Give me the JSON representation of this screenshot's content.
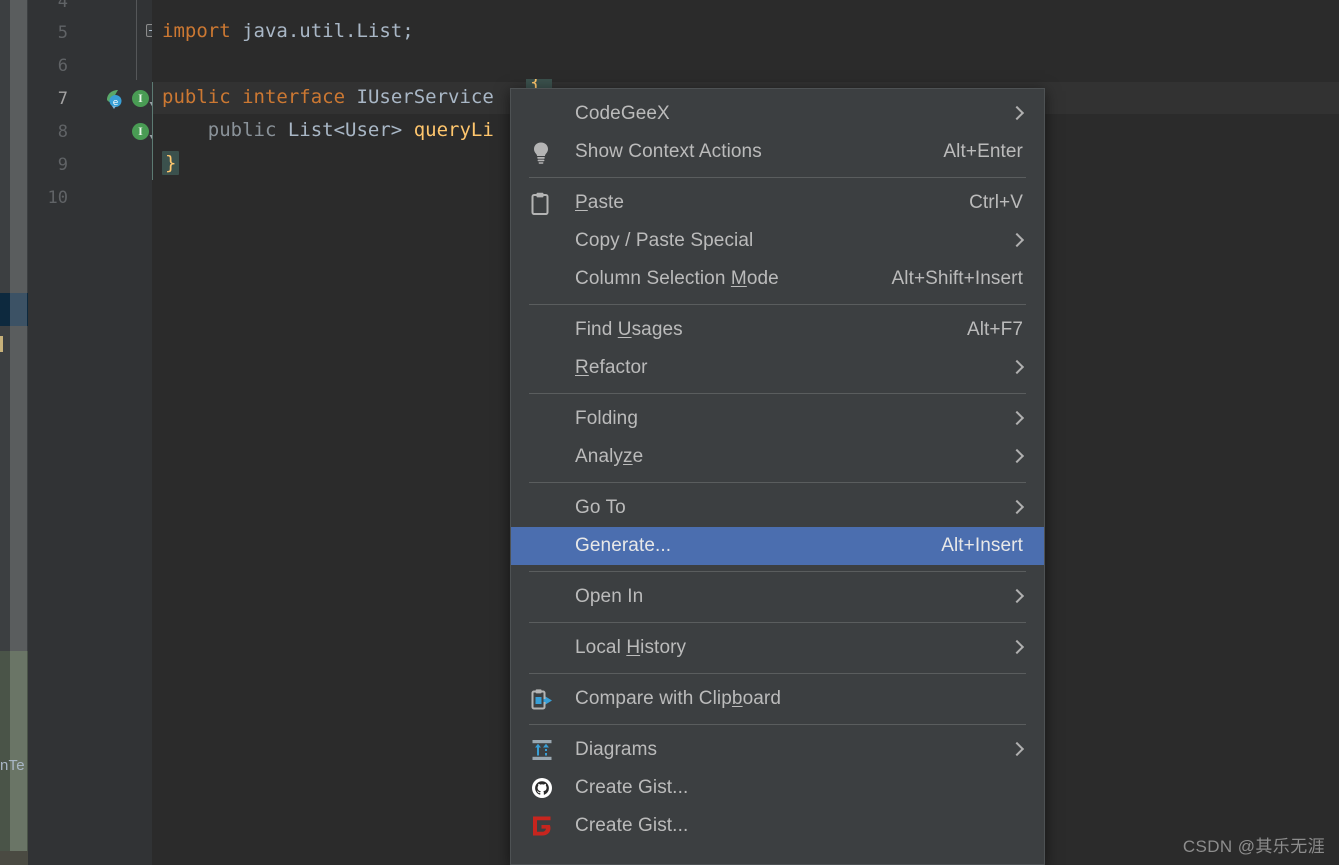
{
  "editor": {
    "gutter": {
      "line_numbers": [
        "4",
        "5",
        "6",
        "7",
        "8",
        "9",
        "10"
      ],
      "current_line": "7",
      "icons": [
        {
          "name": "mybatis-mapper-icon",
          "line": "7"
        },
        {
          "name": "implementation-badge-icon",
          "line": "7",
          "glyph": "I"
        },
        {
          "name": "implementation-badge-icon",
          "line": "8",
          "glyph": "I"
        }
      ]
    },
    "code_lines": [
      {
        "num": "5",
        "segments": [
          {
            "t": "import",
            "c": "kw"
          },
          {
            "t": " java",
            "c": "plain"
          },
          {
            "t": ".util.",
            "c": "plain"
          },
          {
            "t": "List",
            "c": "plain"
          },
          {
            "t": ";",
            "c": "plain"
          }
        ]
      },
      {
        "num": "6",
        "segments": []
      },
      {
        "num": "7",
        "segments": [
          {
            "t": "public",
            "c": "kw"
          },
          {
            "t": " ",
            "c": "plain"
          },
          {
            "t": "interface",
            "c": "kw"
          },
          {
            "t": " ",
            "c": "plain"
          },
          {
            "t": "IUserService",
            "c": "cls"
          }
        ]
      },
      {
        "num": "8",
        "segments": [
          {
            "t": "    ",
            "c": "plain"
          },
          {
            "t": "public",
            "c": "dim"
          },
          {
            "t": " ",
            "c": "plain"
          },
          {
            "t": "List<User>",
            "c": "plain"
          },
          {
            "t": " ",
            "c": "plain"
          },
          {
            "t": "queryLi",
            "c": "mtd"
          }
        ]
      },
      {
        "num": "9",
        "segments": [
          {
            "t": "}",
            "c": "brace-hl"
          }
        ]
      }
    ],
    "line5_text": "import java.util.List;",
    "line7_text": "public interface IUserService",
    "line8_text": "public List<User> queryLi",
    "line9_text": "}",
    "project_tree_label": "nTe"
  },
  "context_menu": {
    "groups": [
      {
        "items": [
          {
            "label": "CodeGeeX",
            "icon": "none",
            "shortcut": "",
            "submenu": true,
            "selected": false,
            "mnemonic": ""
          },
          {
            "label": "Show Context Actions",
            "icon": "lightbulb-icon",
            "shortcut": "Alt+Enter",
            "submenu": false,
            "selected": false,
            "mnemonic": ""
          }
        ]
      },
      {
        "items": [
          {
            "label": "Paste",
            "icon": "clipboard-icon",
            "shortcut": "Ctrl+V",
            "submenu": false,
            "selected": false,
            "mnemonic": "P"
          },
          {
            "label": "Copy / Paste Special",
            "icon": "none",
            "shortcut": "",
            "submenu": true,
            "selected": false,
            "mnemonic": ""
          },
          {
            "label": "Column Selection Mode",
            "icon": "none",
            "shortcut": "Alt+Shift+Insert",
            "submenu": false,
            "selected": false,
            "mnemonic": "M"
          }
        ]
      },
      {
        "items": [
          {
            "label": "Find Usages",
            "icon": "none",
            "shortcut": "Alt+F7",
            "submenu": false,
            "selected": false,
            "mnemonic": "U"
          },
          {
            "label": "Refactor",
            "icon": "none",
            "shortcut": "",
            "submenu": true,
            "selected": false,
            "mnemonic": "R"
          }
        ]
      },
      {
        "items": [
          {
            "label": "Folding",
            "icon": "none",
            "shortcut": "",
            "submenu": true,
            "selected": false,
            "mnemonic": ""
          },
          {
            "label": "Analyze",
            "icon": "none",
            "shortcut": "",
            "submenu": true,
            "selected": false,
            "mnemonic": "z"
          }
        ]
      },
      {
        "items": [
          {
            "label": "Go To",
            "icon": "none",
            "shortcut": "",
            "submenu": true,
            "selected": false,
            "mnemonic": ""
          },
          {
            "label": "Generate...",
            "icon": "none",
            "shortcut": "Alt+Insert",
            "submenu": false,
            "selected": true,
            "mnemonic": ""
          }
        ]
      },
      {
        "items": [
          {
            "label": "Open In",
            "icon": "none",
            "shortcut": "",
            "submenu": true,
            "selected": false,
            "mnemonic": ""
          }
        ]
      },
      {
        "items": [
          {
            "label": "Local History",
            "icon": "none",
            "shortcut": "",
            "submenu": true,
            "selected": false,
            "mnemonic": "H"
          }
        ]
      },
      {
        "items": [
          {
            "label": "Compare with Clipboard",
            "icon": "compare-clipboard-icon",
            "shortcut": "",
            "submenu": false,
            "selected": false,
            "mnemonic": "b"
          }
        ]
      },
      {
        "items": [
          {
            "label": "Diagrams",
            "icon": "diagrams-icon",
            "shortcut": "",
            "submenu": true,
            "selected": false,
            "mnemonic": ""
          },
          {
            "label": "Create Gist...",
            "icon": "github-icon",
            "shortcut": "",
            "submenu": false,
            "selected": false,
            "mnemonic": ""
          },
          {
            "label": "Create Gist...",
            "icon": "gitee-icon",
            "shortcut": "",
            "submenu": false,
            "selected": false,
            "mnemonic": ""
          }
        ]
      }
    ]
  },
  "watermark": {
    "text": "CSDN @其乐无涯"
  },
  "colors": {
    "menu_bg": "#3c3f41",
    "menu_highlight": "#4b6eaf",
    "menu_text": "#bbbbbb",
    "editor_bg": "#2b2b2b",
    "gutter_bg": "#313335",
    "keyword": "#cc7832",
    "identifier": "#a9b7c6",
    "method": "#ffc66d",
    "current_line": "#323232",
    "badge_green": "#499c54",
    "gitee_red": "#c7251e"
  }
}
